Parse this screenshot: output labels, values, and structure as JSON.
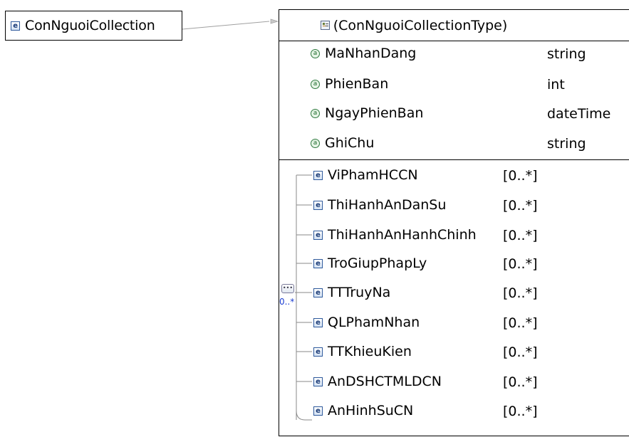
{
  "root_element": {
    "name": "ConNguoiCollection",
    "icon": "e"
  },
  "type": {
    "name": "(ConNguoiCollectionType)",
    "attributes": [
      {
        "name": "MaNhanDang",
        "type": "string"
      },
      {
        "name": "PhienBan",
        "type": "int"
      },
      {
        "name": "NgayPhienBan",
        "type": "dateTime"
      },
      {
        "name": "GhiChu",
        "type": "string"
      }
    ],
    "sequence": {
      "cardinality": "0..*",
      "elements": [
        {
          "name": "ViPhamHCCN",
          "cardinality": "[0..*]"
        },
        {
          "name": "ThiHanhAnDanSu",
          "cardinality": "[0..*]"
        },
        {
          "name": "ThiHanhAnHanhChinh",
          "cardinality": "[0..*]"
        },
        {
          "name": "TroGiupPhapLy",
          "cardinality": "[0..*]"
        },
        {
          "name": "TTTruyNa",
          "cardinality": "[0..*]"
        },
        {
          "name": "QLPhamNhan",
          "cardinality": "[0..*]"
        },
        {
          "name": "TTKhieuKien",
          "cardinality": "[0..*]"
        },
        {
          "name": "AnDSHCTMLDCN",
          "cardinality": "[0..*]"
        },
        {
          "name": "AnHinhSuCN",
          "cardinality": "[0..*]"
        }
      ]
    }
  },
  "colors": {
    "element_icon": "#2f5a9c",
    "attribute_icon": "#2f7a3f",
    "sequence_cardinality": "#1a3cd0"
  }
}
